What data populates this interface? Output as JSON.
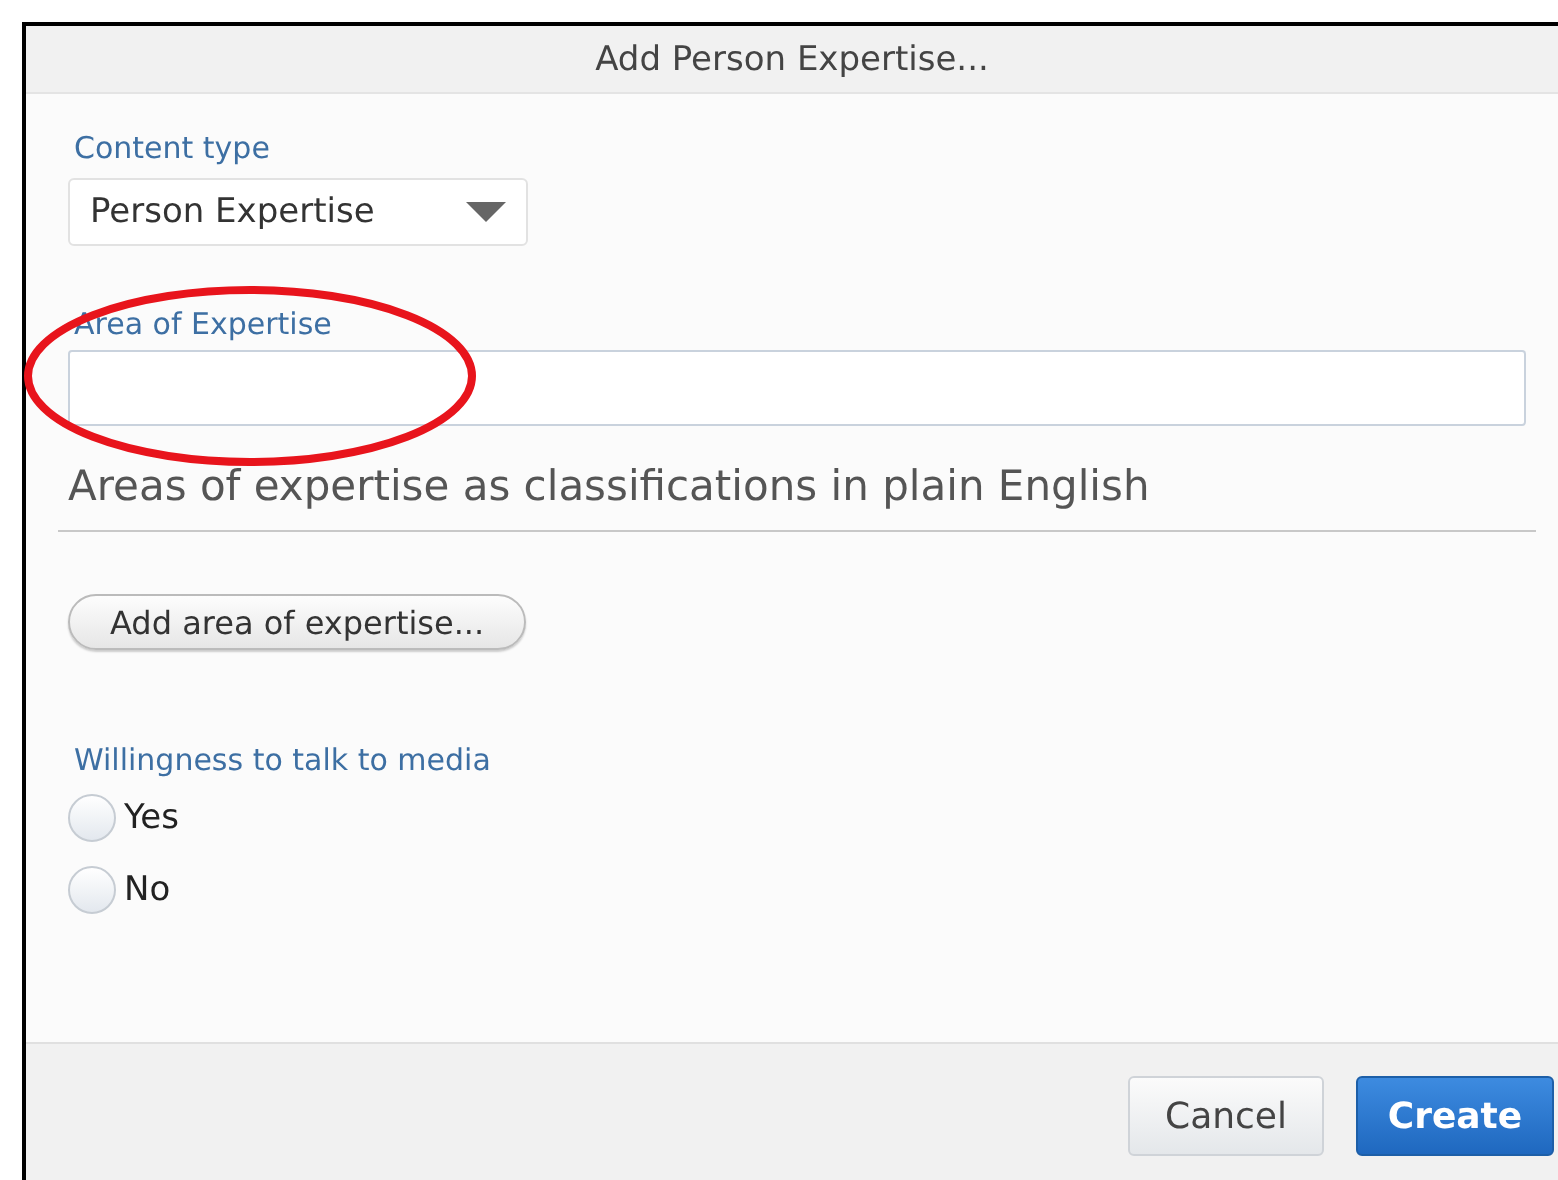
{
  "window": {
    "title": "Add Person Expertise..."
  },
  "content_type": {
    "label": "Content type",
    "value": "Person Expertise"
  },
  "area": {
    "label": "Area of Expertise",
    "heading": "Areas of expertise as classifications in plain English",
    "add_button": "Add area of expertise..."
  },
  "media": {
    "label": "Willingness to talk to media",
    "options": [
      {
        "label": "Yes",
        "selected": false
      },
      {
        "label": "No",
        "selected": false
      }
    ]
  },
  "buttons": [
    {
      "label": "Cancel",
      "primary": false
    },
    {
      "label": "Create",
      "primary": true
    }
  ]
}
